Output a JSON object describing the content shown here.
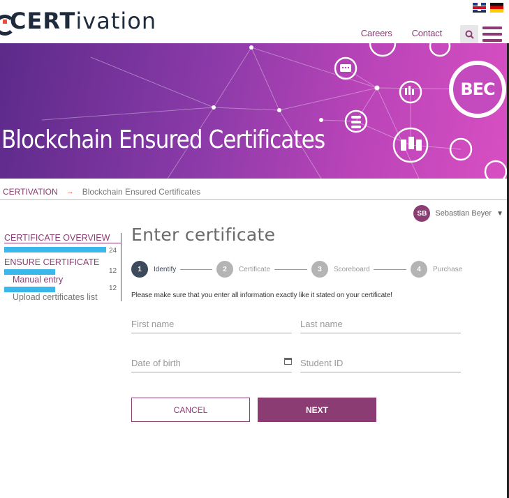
{
  "header": {
    "logo_bold": "CERT",
    "logo_light": "ivation",
    "nav": [
      "Careers",
      "Contact"
    ]
  },
  "hero": {
    "title": "Blockchain Ensured Certificates",
    "badge": "BEC"
  },
  "breadcrumb": {
    "root": "CERTIVATION",
    "separator": "→",
    "current": "Blockchain Ensured Certificates"
  },
  "user": {
    "initials": "SB",
    "name": "Sebastian Beyer"
  },
  "sidebar": {
    "items": [
      {
        "label": "CERTIFICATE OVERVIEW",
        "count": "24",
        "fill": 1.0
      },
      {
        "label": "ENSURE CERTIFICATE",
        "count": "12",
        "fill": 0.5
      },
      {
        "label": "Manual entry",
        "count": "12",
        "fill": 0.5
      },
      {
        "label": "Upload certificates list"
      }
    ]
  },
  "main": {
    "title": "Enter certificate",
    "steps": [
      {
        "num": "1",
        "label": "Identify",
        "active": true
      },
      {
        "num": "2",
        "label": "Certificate",
        "active": false
      },
      {
        "num": "3",
        "label": "Scoreboard",
        "active": false
      },
      {
        "num": "4",
        "label": "Purchase",
        "active": false
      }
    ],
    "hint": "Please make sure that you enter all information exactly like it stated on your certificate!",
    "fields": {
      "first_name": "First name",
      "last_name": "Last name",
      "date_of_birth": "Date of birth",
      "student_id": "Student ID"
    },
    "cancel_label": "CANCEL",
    "next_label": "NEXT"
  },
  "colors": {
    "brand": "#8b3d73",
    "progress": "#3ab8ec",
    "step_active": "#3c4a5c"
  }
}
